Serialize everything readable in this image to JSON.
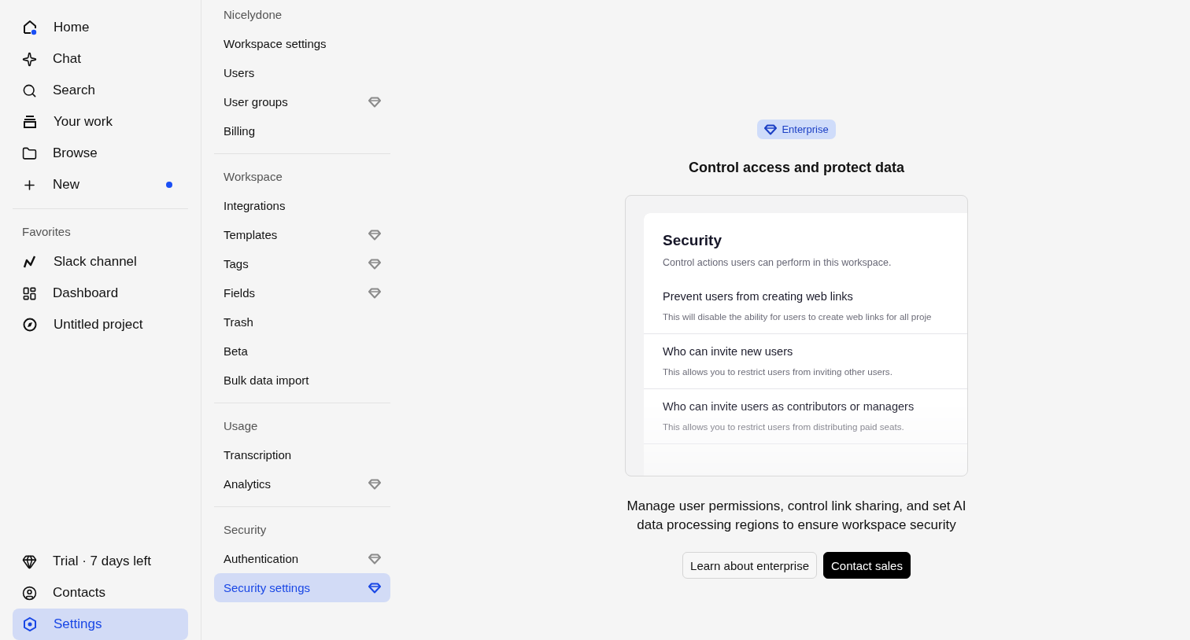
{
  "sidebar": {
    "nav_items": [
      {
        "label": "Home",
        "notification": false
      },
      {
        "label": "Chat",
        "notification": false
      },
      {
        "label": "Search",
        "notification": false
      },
      {
        "label": "Your work",
        "notification": false
      },
      {
        "label": "Browse",
        "notification": false
      },
      {
        "label": "New",
        "notification": true
      }
    ],
    "favorites": {
      "title": "Favorites",
      "items": [
        {
          "label": "Slack channel"
        },
        {
          "label": "Dashboard"
        },
        {
          "label": "Untitled project"
        }
      ]
    },
    "bottom_items": [
      {
        "label": "Trial · 7 days left",
        "selected": false
      },
      {
        "label": "Contacts",
        "selected": false
      },
      {
        "label": "Settings",
        "selected": true
      }
    ]
  },
  "settings_nav": {
    "sections": [
      {
        "title": "Nicelydone",
        "items": [
          {
            "label": "Workspace settings",
            "enterprise": false,
            "selected": false
          },
          {
            "label": "Users",
            "enterprise": false,
            "selected": false
          },
          {
            "label": "User groups",
            "enterprise": true,
            "selected": false
          },
          {
            "label": "Billing",
            "enterprise": false,
            "selected": false
          }
        ]
      },
      {
        "title": "Workspace",
        "items": [
          {
            "label": "Integrations",
            "enterprise": false,
            "selected": false
          },
          {
            "label": "Templates",
            "enterprise": true,
            "selected": false
          },
          {
            "label": "Tags",
            "enterprise": true,
            "selected": false
          },
          {
            "label": "Fields",
            "enterprise": true,
            "selected": false
          },
          {
            "label": "Trash",
            "enterprise": false,
            "selected": false
          },
          {
            "label": "Beta",
            "enterprise": false,
            "selected": false
          },
          {
            "label": "Bulk data import",
            "enterprise": false,
            "selected": false
          }
        ]
      },
      {
        "title": "Usage",
        "items": [
          {
            "label": "Transcription",
            "enterprise": false,
            "selected": false
          },
          {
            "label": "Analytics",
            "enterprise": true,
            "selected": false
          }
        ]
      },
      {
        "title": "Security",
        "items": [
          {
            "label": "Authentication",
            "enterprise": true,
            "selected": false
          },
          {
            "label": "Security settings",
            "enterprise": true,
            "selected": true
          }
        ]
      }
    ]
  },
  "main": {
    "badge": "Enterprise",
    "title": "Control access and protect data",
    "preview": {
      "title": "Security",
      "subtitle": "Control actions users can perform in this workspace.",
      "rows": [
        {
          "title": "Prevent users from creating web links",
          "description": "This will disable the ability for users to create web links for all proje"
        },
        {
          "title": "Who can invite new users",
          "description": "This allows you to restrict users from inviting other users."
        },
        {
          "title": "Who can invite users as contributors or managers",
          "description": "This allows you to restrict users from distributing paid seats."
        }
      ]
    },
    "description": "Manage user permissions, control link sharing, and set AI data processing regions to ensure workspace security",
    "buttons": [
      {
        "label": "Learn about enterprise",
        "kind": "secondary"
      },
      {
        "label": "Contact sales",
        "kind": "primary"
      }
    ]
  }
}
